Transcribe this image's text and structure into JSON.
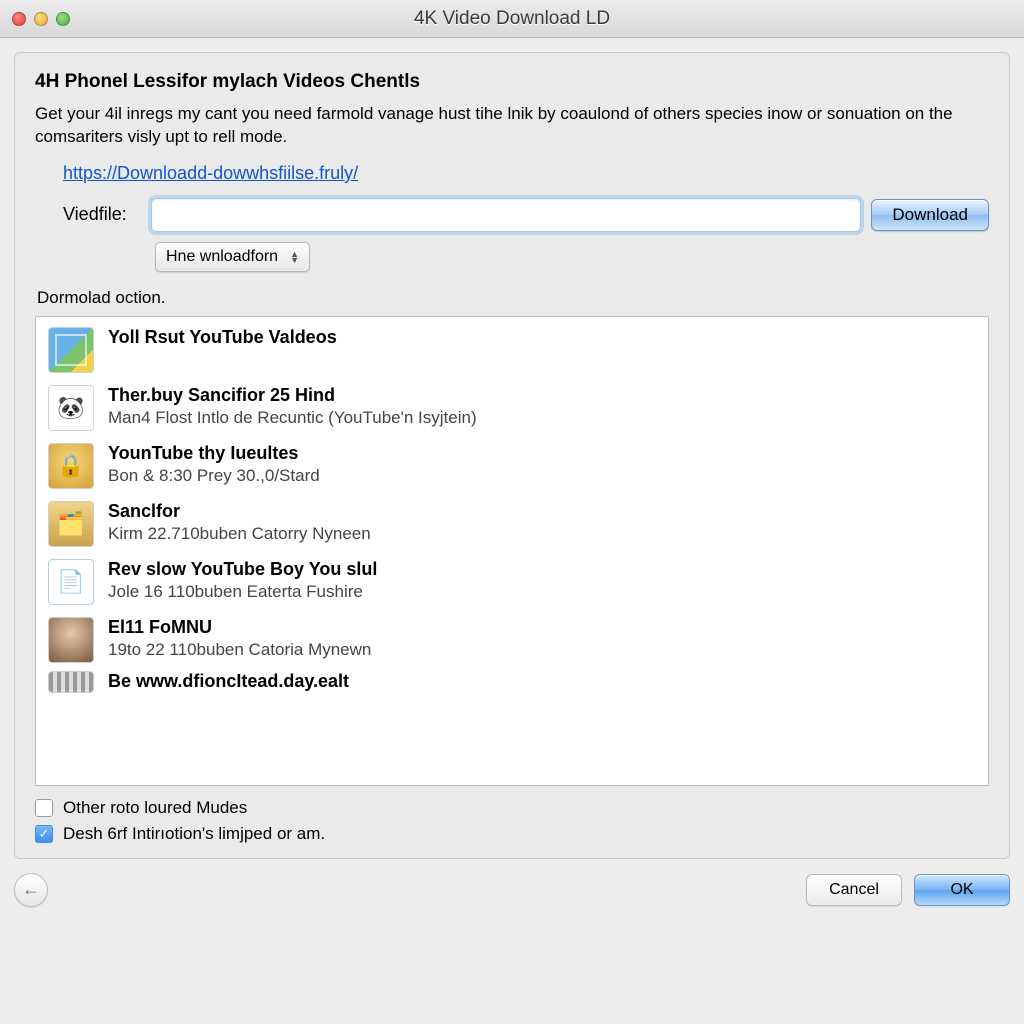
{
  "window": {
    "title": "4K Video Download LD"
  },
  "header": {
    "heading": "4H Phonel Lessifor mylach Videos Chentls",
    "description": "Get your 4il inregs my cant you need farmold vanage hust tihe lnik by coaulond of others species inow or sonuation on the comsariters visly upt to rell mode.",
    "link_text": "https://Downloadd-dowwhsfiilse.fruly/",
    "field_label": "Viedfile:",
    "url_value": "",
    "download_label": "Download",
    "format_label": "Hne wnloadforn"
  },
  "list_heading": "Dormolad oction.",
  "items": [
    {
      "title": "Yoll Rsut YouTube Valdeos",
      "subtitle": ""
    },
    {
      "title": "Ther.buy Sancifior 25 Hind",
      "subtitle": "Man4 Flost Intlo de Recuntic (YouTube'n Isyjtein)"
    },
    {
      "title": "YounTube thy Iueultes",
      "subtitle": "Bon & 8:30 Prey 30.,0/Stard"
    },
    {
      "title": "Sanclfor",
      "subtitle": "Kirm 22.710buben Catorry Nyneen"
    },
    {
      "title": "Rev slow YouTube Boy You slul",
      "subtitle": "Jole 16 110buben Eaterta Fushire"
    },
    {
      "title": "El11 FoMNU",
      "subtitle": "19to 22 110buben Catoria Mynewn"
    },
    {
      "title": "Be www.dfioncItead.day.ealt",
      "subtitle": ""
    }
  ],
  "options": {
    "opt1_label": "Other roto loured Mudes",
    "opt1_checked": false,
    "opt2_label": "Desh 6rf Intirıotion's limjped or am.",
    "opt2_checked": true
  },
  "footer": {
    "cancel_label": "Cancel",
    "ok_label": "OK"
  }
}
